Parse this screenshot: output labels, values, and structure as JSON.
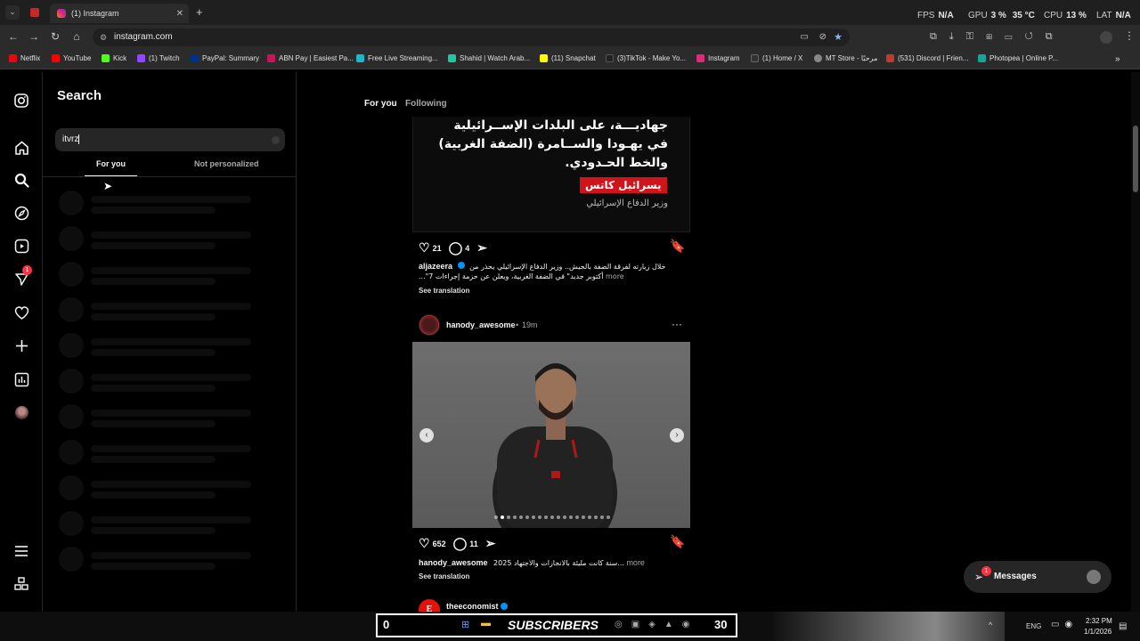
{
  "browser": {
    "tab_title": "(1) Instagram",
    "new_tab": "+",
    "url": "instagram.com",
    "hud": {
      "fps_label": "FPS",
      "fps_value": "N/A",
      "gpu_label": "GPU",
      "gpu_value": "3 %",
      "gpu_temp": "35 °C",
      "cpu_label": "CPU",
      "cpu_value": "13 %",
      "lat_label": "LAT",
      "lat_value": "N/A"
    },
    "bookmarks": [
      {
        "label": "Netflix",
        "color": "#e50914"
      },
      {
        "label": "YouTube",
        "color": "#ff0000"
      },
      {
        "label": "Kick",
        "color": "#53fc18"
      },
      {
        "label": "(1) Twitch",
        "color": "#9146ff"
      },
      {
        "label": "PayPal: Summary",
        "color": "#003087"
      },
      {
        "label": "ABN Pay | Easiest Pa...",
        "color": "#c2185b"
      },
      {
        "label": "Free Live Streaming...",
        "color": "#1fb6c9"
      },
      {
        "label": "Shahid | Watch Arab...",
        "color": "#1ec8a5"
      },
      {
        "label": "(11) Snapchat",
        "color": "#fffc00"
      },
      {
        "label": "(3)TikTok - Make Yo...",
        "color": "#222222"
      },
      {
        "label": "Instagram",
        "color": "#dd2a7b"
      },
      {
        "label": "(1) Home / X",
        "color": "#333333"
      },
      {
        "label": "MT Store - مرحبًا",
        "color": "#888888"
      },
      {
        "label": "(531) Discord | Frien...",
        "color": "#c0392b"
      },
      {
        "label": "Photopea | Online P...",
        "color": "#18a497"
      }
    ]
  },
  "search_panel": {
    "title": "Search",
    "query": "itvrz",
    "tabs": [
      "For you",
      "Not personalized"
    ]
  },
  "feed": {
    "tabs": [
      "For you",
      "Following"
    ],
    "post1": {
      "arabic_lines": [
        "جهاديـــة، على البلدات الإســرائيلية",
        "في يهـودا والســامرة (الضفة الغربية)",
        "والخط الحـدودي."
      ],
      "tag": "يسرائيل كاتس",
      "tag_sub": "وزير الدفاع الإسرائيلي",
      "likes": "21",
      "comments": "4",
      "author": "aljazeera",
      "caption_1": "خلال زيارته لفرقة الضفة بالجيش.. وزير الدفاع الإسرائيلي يحذر من",
      "caption_2": "...\"7 أكتوبر جديد\" في الضفة الغربية، ويعلن عن حزمة إجراءات",
      "more": "more",
      "see_translation": "See translation"
    },
    "post2": {
      "author": "hanody_awesome",
      "time": "19m",
      "likes": "652",
      "comments": "11",
      "caption": "2025 سنة كانت مليئة بالانجازات والاجتهاد...",
      "more": "more",
      "see_translation": "See translation"
    },
    "post3": {
      "author": "theeconomist"
    }
  },
  "messages": {
    "label": "Messages",
    "badge": "1"
  },
  "notif_badge": "1",
  "overlay": {
    "left": "0",
    "text": "SUBSCRIBERS",
    "right": "30"
  },
  "taskbar": {
    "lang": "ENG",
    "time": "2:32 PM",
    "date": "1/1/2026"
  },
  "colors": {
    "accent": "#0095f6",
    "badge": "#ff3040",
    "bg": "#000000"
  }
}
